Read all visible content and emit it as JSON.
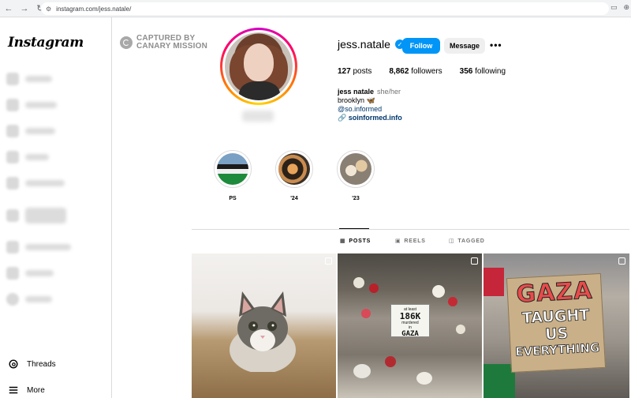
{
  "browser": {
    "url": "instagram.com/jess.natale/",
    "icons": [
      "back-icon",
      "forward-icon",
      "reload-icon",
      "tune-icon",
      "screen-icon",
      "zoom-icon"
    ]
  },
  "sidebar": {
    "logo": "Instagram",
    "items": [
      {
        "label": "Threads",
        "icon": "threads-icon"
      },
      {
        "label": "More",
        "icon": "menu-icon"
      }
    ]
  },
  "watermark": {
    "line1": "CAPTURED BY",
    "line2": "CANARY MISSION"
  },
  "profile": {
    "username": "jess.natale",
    "verified": true,
    "follow_label": "Follow",
    "message_label": "Message",
    "more_label": "•••",
    "stats": {
      "posts_value": "127",
      "posts_label": "posts",
      "followers_value": "8,862",
      "followers_label": "followers",
      "following_value": "356",
      "following_label": "following"
    },
    "bio": {
      "name": "jess natale",
      "pronouns": "she/her",
      "line1": "brooklyn 🦋",
      "mention": "@so.informed",
      "link": "soinformed.info"
    }
  },
  "highlights": [
    {
      "label": "PS"
    },
    {
      "label": "'24"
    },
    {
      "label": "'23"
    }
  ],
  "tabs": [
    {
      "label": "POSTS",
      "icon": "grid-icon",
      "active": true
    },
    {
      "label": "REELS",
      "icon": "reels-icon",
      "active": false
    },
    {
      "label": "TAGGED",
      "icon": "tagged-icon",
      "active": false
    }
  ],
  "posts": [
    {
      "kind": "kitten photo",
      "multi": true
    },
    {
      "kind": "memorial",
      "multi": true,
      "sign": {
        "l1": "at least",
        "l2": "186K",
        "l3": "murdered",
        "l4": "in",
        "l5": "GAZA"
      }
    },
    {
      "kind": "protest sign",
      "multi": true,
      "sign": {
        "l1": "GAZA",
        "l2": "TAUGHT US",
        "l3": "EVERYTHING"
      }
    }
  ],
  "colors": {
    "follow_bg": "#0095f6",
    "message_bg": "#efefef",
    "link": "#00376b",
    "muted": "#737373",
    "border": "#dbdbdb"
  }
}
